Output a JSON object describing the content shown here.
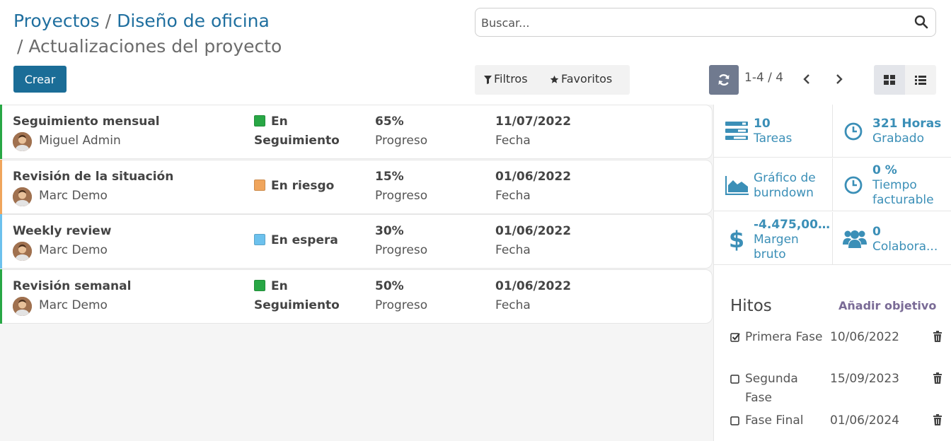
{
  "breadcrumb": {
    "parent": "Proyectos",
    "sep1": "/",
    "project": "Diseño de oficina",
    "sep2": "/",
    "current": "Actualizaciones del proyecto"
  },
  "toolbar": {
    "create_label": "Crear",
    "search_placeholder": "Buscar...",
    "filters_label": "Filtros",
    "favorites_label": "Favoritos",
    "pager": "1-4 / 4",
    "active_view": "kanban"
  },
  "colors": {
    "primary": "#1b6d97",
    "link": "#1f6f9f",
    "stat_accent": "#3b8fb7",
    "on_track": "#28a745",
    "at_risk": "#f0a55c",
    "on_hold": "#6cc1ed"
  },
  "updates": [
    {
      "title": "Seguimiento mensual",
      "user": "Miguel Admin",
      "status": "En Seguimiento",
      "status_color": "#28a745",
      "progress": "65%",
      "progress_label": "Progreso",
      "date": "11/07/2022",
      "date_label": "Fecha"
    },
    {
      "title": "Revisión de la situación",
      "user": "Marc Demo",
      "status": "En riesgo",
      "status_color": "#f0a55c",
      "progress": "15%",
      "progress_label": "Progreso",
      "date": "01/06/2022",
      "date_label": "Fecha"
    },
    {
      "title": "Weekly review",
      "user": "Marc Demo",
      "status": "En espera",
      "status_color": "#6cc1ed",
      "progress": "30%",
      "progress_label": "Progreso",
      "date": "01/06/2022",
      "date_label": "Fecha"
    },
    {
      "title": "Revisión semanal",
      "user": "Marc Demo",
      "status": "En Seguimiento",
      "status_color": "#28a745",
      "progress": "50%",
      "progress_label": "Progreso",
      "date": "01/06/2022",
      "date_label": "Fecha"
    }
  ],
  "stats": {
    "tasks": {
      "value": "10",
      "label": "Tareas",
      "icon": "tasks-icon"
    },
    "hours": {
      "value": "321 Horas",
      "label": "Grabado",
      "icon": "clock-icon"
    },
    "burndown": {
      "label": "Gráfico de burndown",
      "icon": "area-chart-icon"
    },
    "billable": {
      "value": "0 %",
      "label": "Tiempo facturable",
      "icon": "clock-icon"
    },
    "margin": {
      "value": "-4.475,00...",
      "label": "Margen bruto",
      "icon": "dollar-icon"
    },
    "collaborators": {
      "value": "0",
      "label": "Colabora...",
      "icon": "users-icon"
    }
  },
  "milestones": {
    "title": "Hitos",
    "add_label": "Añadir objetivo",
    "items": [
      {
        "name": "Primera Fase",
        "date": "10/06/2022",
        "done": true
      },
      {
        "name": "Segunda Fase",
        "date": "15/09/2023",
        "done": false
      },
      {
        "name": "Fase Final",
        "date": "01/06/2024",
        "done": false
      }
    ]
  }
}
